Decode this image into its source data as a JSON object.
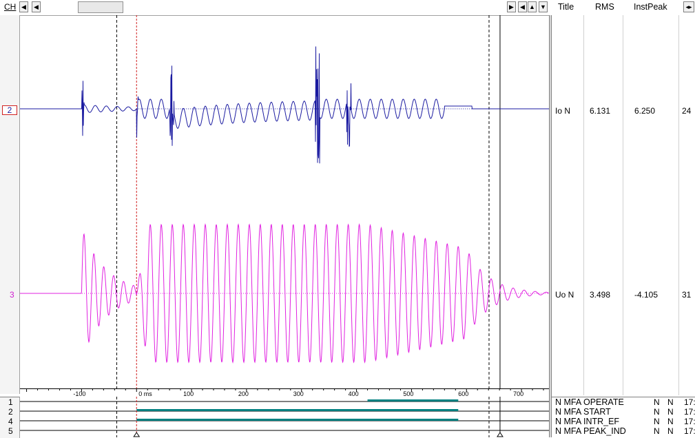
{
  "toolbar": {
    "ch_label": "CH",
    "nav_left_end": "◀",
    "nav_left": "◀",
    "nav_right": "▶",
    "nav_first": "◀",
    "nav_up": "▲",
    "nav_down": "▼",
    "nav_expand": "◂▸"
  },
  "table_header": {
    "title": "Title",
    "rms": "RMS",
    "instpeak": "InstPeak"
  },
  "channels": [
    {
      "num": "2",
      "title": "Io N",
      "rms": "6.131",
      "instpeak": "6.250",
      "extra": "24",
      "color": "#1a1aa0"
    },
    {
      "num": "3",
      "title": "Uo N",
      "rms": "3.498",
      "instpeak": "-4.105",
      "extra": "31",
      "color": "#e020e0"
    }
  ],
  "time_axis": {
    "ticks": [
      "-100",
      "0 ms",
      "100",
      "200",
      "300",
      "400",
      "500",
      "600",
      "700"
    ],
    "tick_values": [
      -100,
      0,
      100,
      200,
      300,
      400,
      500,
      600,
      700
    ],
    "range": [
      -212,
      750
    ]
  },
  "cursors": {
    "red_ms": 0,
    "dashed_left_ms": -36,
    "dashed_right_ms": 641,
    "solid_right_ms": 661
  },
  "binary": [
    {
      "num": "1",
      "name": "N MFA OPERATE",
      "f1": "N",
      "f2": "N",
      "time": "17:",
      "on": [
        [
          420,
          585
        ]
      ]
    },
    {
      "num": "2",
      "name": "N MFA START",
      "f1": "N",
      "f2": "N",
      "time": "17:",
      "on": [
        [
          0,
          585
        ]
      ]
    },
    {
      "num": "4",
      "name": "N MFA INTR_EF",
      "f1": "N",
      "f2": "N",
      "time": "17:",
      "on": [
        [
          0,
          585
        ]
      ]
    },
    {
      "num": "5",
      "name": "N MFA PEAK_IND",
      "f1": "N",
      "f2": "N",
      "time": "17:",
      "on": []
    }
  ],
  "colors": {
    "teal": "#008080",
    "grid": "#000000",
    "cursor_red": "#d02020"
  }
}
